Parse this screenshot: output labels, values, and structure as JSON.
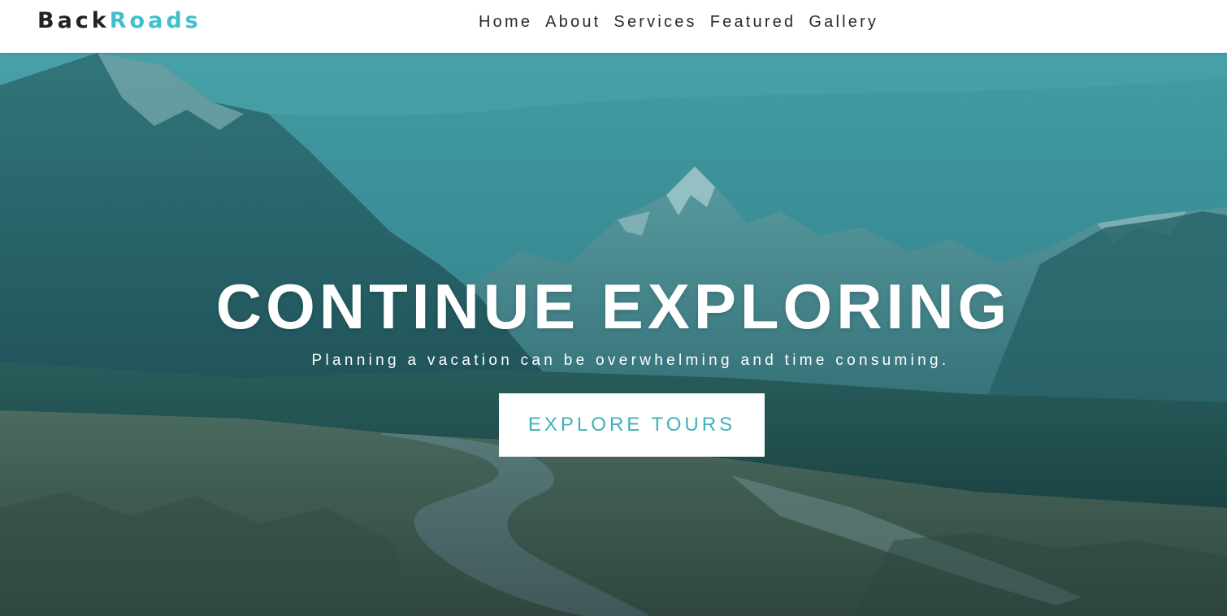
{
  "brand": {
    "part1": "Back",
    "part2": "Roads"
  },
  "nav": {
    "items": [
      {
        "label": "Home"
      },
      {
        "label": "About"
      },
      {
        "label": "Services"
      },
      {
        "label": "Featured"
      },
      {
        "label": "Gallery"
      }
    ]
  },
  "hero": {
    "title": "CONTINUE EXPLORING",
    "subtitle": "Planning a vacation can be overwhelming and time consuming.",
    "button_label": "EXPLORE TOURS"
  },
  "colors": {
    "accent": "#3fc0cb",
    "button_text": "#3fb1ba",
    "nav_text": "#2a2a2a",
    "hero_tint": "#2f6f73"
  }
}
